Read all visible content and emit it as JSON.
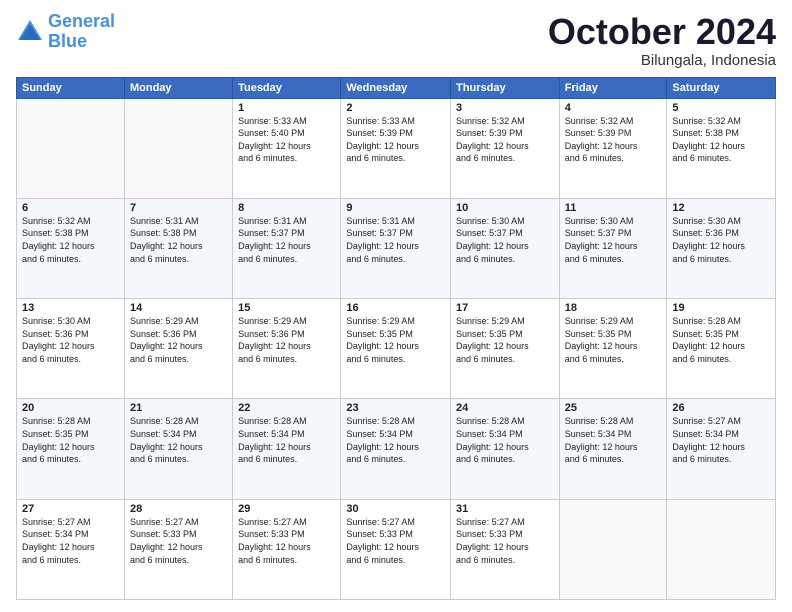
{
  "header": {
    "logo_line1": "General",
    "logo_line2": "Blue",
    "month": "October 2024",
    "location": "Bilungala, Indonesia"
  },
  "weekdays": [
    "Sunday",
    "Monday",
    "Tuesday",
    "Wednesday",
    "Thursday",
    "Friday",
    "Saturday"
  ],
  "weeks": [
    [
      {
        "day": "",
        "info": ""
      },
      {
        "day": "",
        "info": ""
      },
      {
        "day": "1",
        "info": "Sunrise: 5:33 AM\nSunset: 5:40 PM\nDaylight: 12 hours\nand 6 minutes."
      },
      {
        "day": "2",
        "info": "Sunrise: 5:33 AM\nSunset: 5:39 PM\nDaylight: 12 hours\nand 6 minutes."
      },
      {
        "day": "3",
        "info": "Sunrise: 5:32 AM\nSunset: 5:39 PM\nDaylight: 12 hours\nand 6 minutes."
      },
      {
        "day": "4",
        "info": "Sunrise: 5:32 AM\nSunset: 5:39 PM\nDaylight: 12 hours\nand 6 minutes."
      },
      {
        "day": "5",
        "info": "Sunrise: 5:32 AM\nSunset: 5:38 PM\nDaylight: 12 hours\nand 6 minutes."
      }
    ],
    [
      {
        "day": "6",
        "info": "Sunrise: 5:32 AM\nSunset: 5:38 PM\nDaylight: 12 hours\nand 6 minutes."
      },
      {
        "day": "7",
        "info": "Sunrise: 5:31 AM\nSunset: 5:38 PM\nDaylight: 12 hours\nand 6 minutes."
      },
      {
        "day": "8",
        "info": "Sunrise: 5:31 AM\nSunset: 5:37 PM\nDaylight: 12 hours\nand 6 minutes."
      },
      {
        "day": "9",
        "info": "Sunrise: 5:31 AM\nSunset: 5:37 PM\nDaylight: 12 hours\nand 6 minutes."
      },
      {
        "day": "10",
        "info": "Sunrise: 5:30 AM\nSunset: 5:37 PM\nDaylight: 12 hours\nand 6 minutes."
      },
      {
        "day": "11",
        "info": "Sunrise: 5:30 AM\nSunset: 5:37 PM\nDaylight: 12 hours\nand 6 minutes."
      },
      {
        "day": "12",
        "info": "Sunrise: 5:30 AM\nSunset: 5:36 PM\nDaylight: 12 hours\nand 6 minutes."
      }
    ],
    [
      {
        "day": "13",
        "info": "Sunrise: 5:30 AM\nSunset: 5:36 PM\nDaylight: 12 hours\nand 6 minutes."
      },
      {
        "day": "14",
        "info": "Sunrise: 5:29 AM\nSunset: 5:36 PM\nDaylight: 12 hours\nand 6 minutes."
      },
      {
        "day": "15",
        "info": "Sunrise: 5:29 AM\nSunset: 5:36 PM\nDaylight: 12 hours\nand 6 minutes."
      },
      {
        "day": "16",
        "info": "Sunrise: 5:29 AM\nSunset: 5:35 PM\nDaylight: 12 hours\nand 6 minutes."
      },
      {
        "day": "17",
        "info": "Sunrise: 5:29 AM\nSunset: 5:35 PM\nDaylight: 12 hours\nand 6 minutes."
      },
      {
        "day": "18",
        "info": "Sunrise: 5:29 AM\nSunset: 5:35 PM\nDaylight: 12 hours\nand 6 minutes."
      },
      {
        "day": "19",
        "info": "Sunrise: 5:28 AM\nSunset: 5:35 PM\nDaylight: 12 hours\nand 6 minutes."
      }
    ],
    [
      {
        "day": "20",
        "info": "Sunrise: 5:28 AM\nSunset: 5:35 PM\nDaylight: 12 hours\nand 6 minutes."
      },
      {
        "day": "21",
        "info": "Sunrise: 5:28 AM\nSunset: 5:34 PM\nDaylight: 12 hours\nand 6 minutes."
      },
      {
        "day": "22",
        "info": "Sunrise: 5:28 AM\nSunset: 5:34 PM\nDaylight: 12 hours\nand 6 minutes."
      },
      {
        "day": "23",
        "info": "Sunrise: 5:28 AM\nSunset: 5:34 PM\nDaylight: 12 hours\nand 6 minutes."
      },
      {
        "day": "24",
        "info": "Sunrise: 5:28 AM\nSunset: 5:34 PM\nDaylight: 12 hours\nand 6 minutes."
      },
      {
        "day": "25",
        "info": "Sunrise: 5:28 AM\nSunset: 5:34 PM\nDaylight: 12 hours\nand 6 minutes."
      },
      {
        "day": "26",
        "info": "Sunrise: 5:27 AM\nSunset: 5:34 PM\nDaylight: 12 hours\nand 6 minutes."
      }
    ],
    [
      {
        "day": "27",
        "info": "Sunrise: 5:27 AM\nSunset: 5:34 PM\nDaylight: 12 hours\nand 6 minutes."
      },
      {
        "day": "28",
        "info": "Sunrise: 5:27 AM\nSunset: 5:33 PM\nDaylight: 12 hours\nand 6 minutes."
      },
      {
        "day": "29",
        "info": "Sunrise: 5:27 AM\nSunset: 5:33 PM\nDaylight: 12 hours\nand 6 minutes."
      },
      {
        "day": "30",
        "info": "Sunrise: 5:27 AM\nSunset: 5:33 PM\nDaylight: 12 hours\nand 6 minutes."
      },
      {
        "day": "31",
        "info": "Sunrise: 5:27 AM\nSunset: 5:33 PM\nDaylight: 12 hours\nand 6 minutes."
      },
      {
        "day": "",
        "info": ""
      },
      {
        "day": "",
        "info": ""
      }
    ]
  ]
}
